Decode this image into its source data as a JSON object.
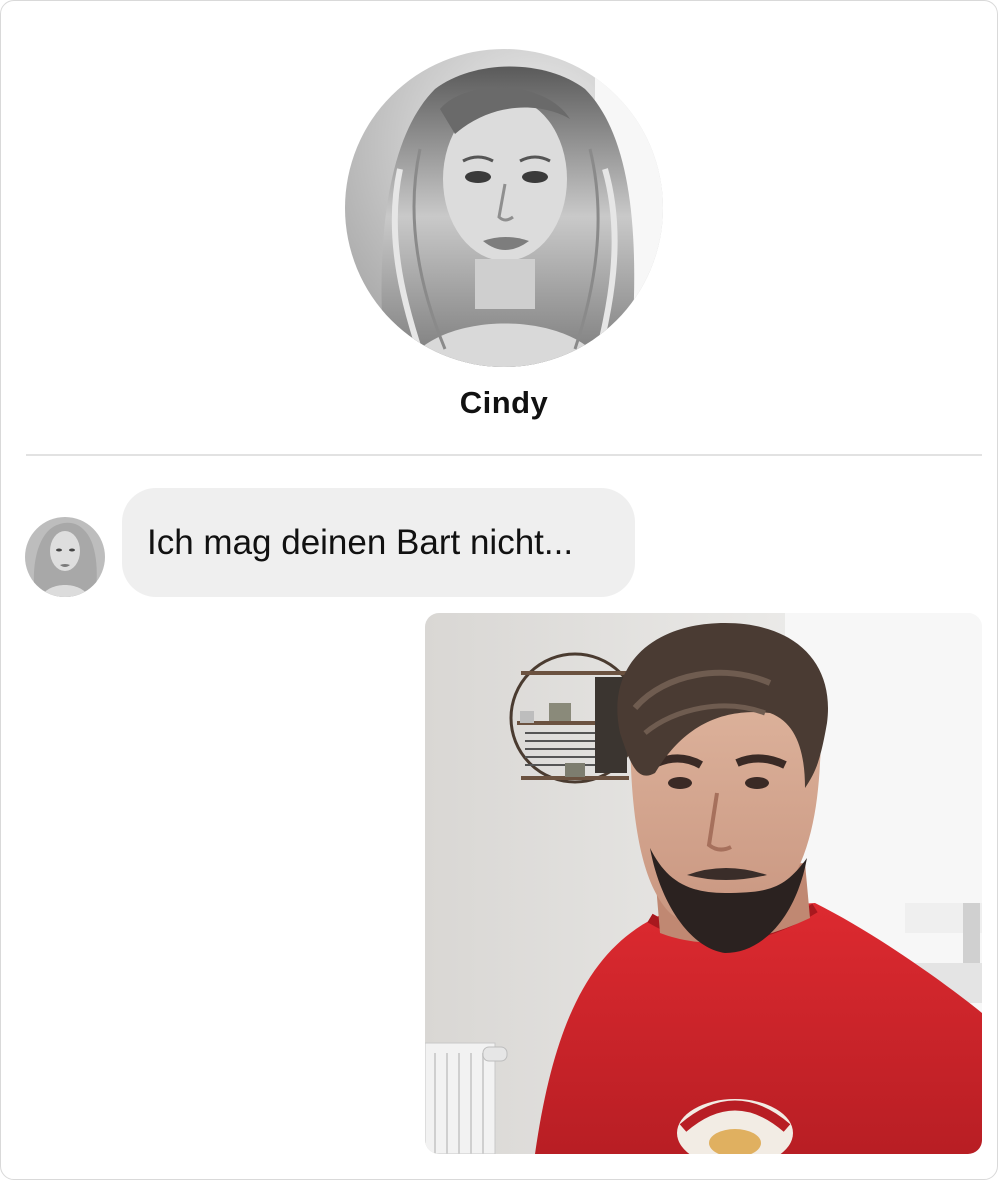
{
  "contact": {
    "name": "Cindy",
    "avatar_icon": "woman-portrait-bw-icon"
  },
  "messages": [
    {
      "sender": "Cindy",
      "type": "text",
      "text": "Ich mag deinen Bart nicht..."
    },
    {
      "sender": "me",
      "type": "image",
      "image_icon": "man-selfie-photo-icon"
    }
  ],
  "colors": {
    "bubble_received": "#efefef",
    "divider": "#e2e2e2",
    "card_border": "#d9d9d9",
    "shirt_red": "#d8262c"
  }
}
